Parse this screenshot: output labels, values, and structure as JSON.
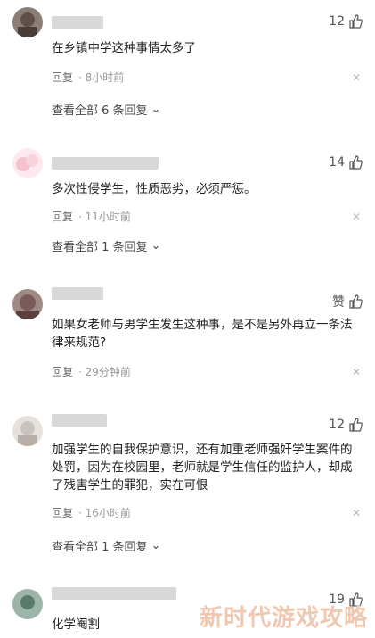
{
  "comments": [
    {
      "likes": "12",
      "text": "在乡镇中学这种事情太多了",
      "reply": "回复",
      "time": "8小时前",
      "view_replies": "查看全部 6 条回复",
      "avatar_color": "#6b5a52"
    },
    {
      "likes": "14",
      "text": "多次性侵学生，性质恶劣，必须严惩。",
      "reply": "回复",
      "time": "11小时前",
      "view_replies": "查看全部 1 条回复",
      "avatar_color": "#f4c2cf"
    },
    {
      "likes": "赞",
      "text": "如果女老师与男学生发生这种事，是不是另外再立一条法律来规范?",
      "reply": "回复",
      "time": "29分钟前",
      "avatar_color": "#7a5a5a"
    },
    {
      "likes": "12",
      "text": "加强学生的自我保护意识，还有加重老师强奸学生案件的处罚，因为在校园里，老师就是学生信任的监护人，却成了残害学生的罪犯，实在可恨",
      "reply": "回复",
      "time": "16小时前",
      "view_replies": "查看全部 1 条回复",
      "avatar_color": "#c9c3bd"
    },
    {
      "likes": "19",
      "text": "化学阉割",
      "avatar_color": "#5a7a6a"
    }
  ],
  "watermark": "新时代游戏攻略"
}
